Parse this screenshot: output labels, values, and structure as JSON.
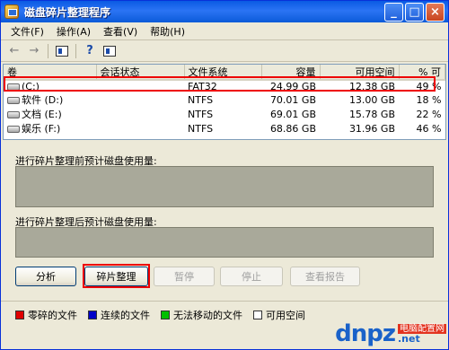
{
  "window": {
    "title": "磁盘碎片整理程序",
    "min_label": "_",
    "max_label": "□",
    "close_label": "×"
  },
  "menu": {
    "items": [
      "文件(F)",
      "操作(A)",
      "查看(V)",
      "帮助(H)"
    ]
  },
  "volumes": {
    "headers": [
      "卷",
      "会话状态",
      "文件系统",
      "容量",
      "可用空间",
      "% 可"
    ],
    "rows": [
      {
        "name": "(C:)",
        "status": "",
        "fs": "FAT32",
        "capacity": "24.99 GB",
        "free": "12.38 GB",
        "pct": "49 %"
      },
      {
        "name": "软件 (D:)",
        "status": "",
        "fs": "NTFS",
        "capacity": "70.01 GB",
        "free": "13.00 GB",
        "pct": "18 %"
      },
      {
        "name": "文档 (E:)",
        "status": "",
        "fs": "NTFS",
        "capacity": "69.01 GB",
        "free": "15.78 GB",
        "pct": "22 %"
      },
      {
        "name": "娱乐 (F:)",
        "status": "",
        "fs": "NTFS",
        "capacity": "68.86 GB",
        "free": "31.96 GB",
        "pct": "46 %"
      }
    ]
  },
  "analysis": {
    "before_label": "进行碎片整理前预计磁盘使用量:",
    "after_label": "进行碎片整理后预计磁盘使用量:"
  },
  "buttons": {
    "analyze": "分析",
    "defrag": "碎片整理",
    "pause": "暂停",
    "stop": "停止",
    "report": "查看报告"
  },
  "legend": {
    "items": [
      {
        "label": "零碎的文件",
        "color": "#e00000"
      },
      {
        "label": "连续的文件",
        "color": "#0000c8"
      },
      {
        "label": "无法移动的文件",
        "color": "#00c000"
      },
      {
        "label": "可用空间",
        "color": "#ffffff"
      }
    ]
  },
  "watermark": {
    "brand": "dnpz",
    "cn": "电脑配置网",
    "domain": ".net"
  },
  "colors": {
    "highlight": "#e00000",
    "bar": "#a9a99a"
  }
}
